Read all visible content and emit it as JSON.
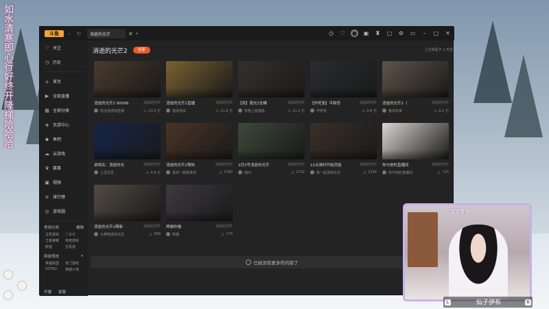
{
  "overlay": {
    "left_text": "如水清寒即心行好终开隆梯哈哈哈"
  },
  "app": {
    "logo_text": "斗鱼",
    "tab": {
      "label": "消逝的光芒"
    }
  },
  "sidebar": {
    "items": [
      {
        "label": "关注",
        "icon": "heart"
      },
      {
        "label": "历史",
        "icon": "clock"
      },
      {
        "label": "首页",
        "icon": "home"
      },
      {
        "label": "全部直播",
        "icon": "play"
      },
      {
        "label": "全部分类",
        "icon": "grid"
      },
      {
        "label": "页游中心",
        "icon": "game"
      },
      {
        "label": "鱼吧",
        "icon": "fish"
      },
      {
        "label": "云游戏",
        "icon": "cloud"
      },
      {
        "label": "赛事",
        "icon": "trophy"
      },
      {
        "label": "视频",
        "icon": "video"
      },
      {
        "label": "排行榜",
        "icon": "rank"
      },
      {
        "label": "游戏圈",
        "icon": "circle"
      }
    ],
    "common": {
      "title": "常用分类",
      "edit": "编辑",
      "items": [
        "主机游戏",
        "二次元",
        "王者荣耀",
        "电竞游戏",
        "颜值",
        "主机游"
      ]
    },
    "recommend": {
      "title": "网游竞技",
      "items": [
        "英雄联盟",
        "热门游戏",
        "DOTA2",
        "穿越火线"
      ]
    },
    "bottom": [
      "开播",
      "客服"
    ]
  },
  "main": {
    "title": "消逝的光芒2",
    "pill": "全部",
    "meta": "上次观看于 1 天前",
    "end_text": "已经没有更多的内容了",
    "cards": [
      {
        "title": "消逝的光芒2 90098",
        "category": "消逝的光芒",
        "user": "防沉迷游戏直播",
        "pop": "23.5 万",
        "thumb": "#4a3a2c"
      },
      {
        "title": "消逝的光芒2直播",
        "category": "消逝的光芒",
        "user": "激进测试",
        "pop": "21.9 万",
        "thumb": "#7a6231"
      },
      {
        "title": "【奈】我光2全模",
        "category": "消逝的光芒",
        "user": "奈我上班摸鱼",
        "pop": "21.2 万",
        "thumb": "#35302c"
      },
      {
        "title": "【作死张】平和恐",
        "category": "消逝的光芒",
        "user": "作死张",
        "pop": "9.8 万",
        "thumb": "#2a2c2e"
      },
      {
        "title": "消逝的光芒2（",
        "category": "消逝的光芒",
        "user": "番本玩家",
        "pop": "6.1 万",
        "thumb": "#5e5449"
      },
      {
        "title": "游戏名：消逝的光",
        "category": "消逝的光芒",
        "user": "土豆先生",
        "pop": "4.8 万",
        "thumb": "#16244a"
      },
      {
        "title": "消逝的光芒2预热",
        "category": "消逝的光芒",
        "user": "豪米一般搞事情",
        "pop": "3780",
        "thumb": "#4a3426"
      },
      {
        "title": "2月5号消逝的光芒",
        "category": "消逝的光芒",
        "user": "俄fd",
        "pop": "2792",
        "thumb": "#3c4a3a"
      },
      {
        "title": "12点准时开始消逝",
        "category": "消逝的光芒",
        "user": "我一起游戏日记",
        "pop": "2334",
        "thumb": "#3a2f28"
      },
      {
        "title": "你与他的直播间",
        "category": "消逝的光芒",
        "user": "你与他的直播间",
        "pop": "725",
        "thumb": "#d8d4d0"
      },
      {
        "title": "消逝的光芒2萌新",
        "category": "消逝的光芒",
        "user": "大黄鸭游戏日志",
        "pop": "699",
        "thumb": "#514b44"
      },
      {
        "title": "熊猫吹喵",
        "category": "消逝的光芒",
        "user": "熊猫",
        "pop": "174",
        "thumb": "#3d3a40"
      }
    ]
  },
  "webcam": {
    "top_label": "宝宝看书",
    "name": "仙子伊布",
    "key_left": "L",
    "key_right": "R"
  },
  "colors": {
    "accent": "#ee5a24",
    "logo": "#f4a331",
    "window_bg": "#232323",
    "cam_border": "#c7b2e8"
  }
}
